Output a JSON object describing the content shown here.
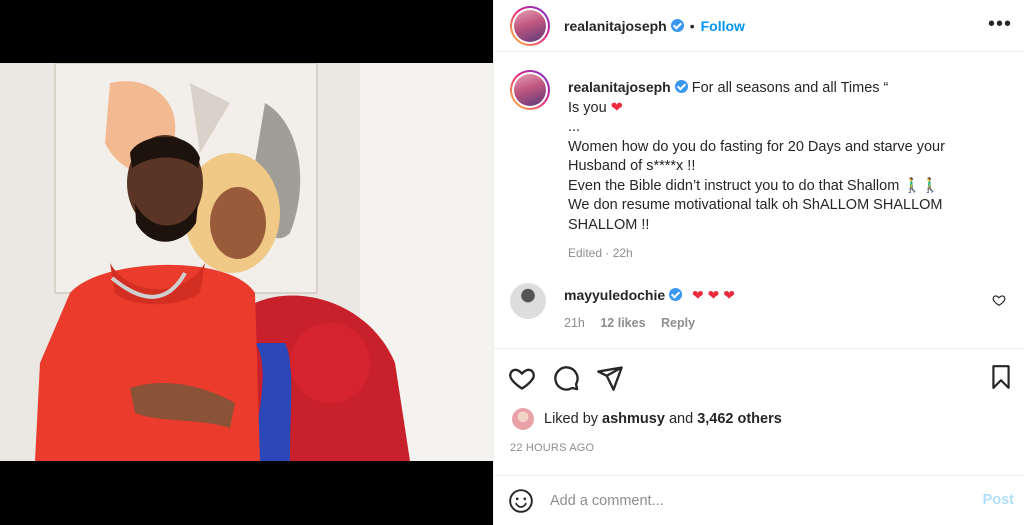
{
  "header": {
    "username": "realanitajoseph",
    "separator": "•",
    "follow_label": "Follow",
    "more_icon": "more-horizontal-icon"
  },
  "caption": {
    "username": "realanitajoseph",
    "line1": "For all seasons and all Times “",
    "line2": "Is you",
    "line2_heart": "❤",
    "line3": "...",
    "line4": "Women how do you do fasting for 20 Days and starve your",
    "line5": "Husband of s****x !!",
    "line6": "Even the Bible didn’t instruct you to do that Shallom 🚶‍♂️🚶‍♂️",
    "line7": "We don resume motivational talk oh ShALLOM SHALLOM",
    "line8": "SHALLOM !!",
    "meta": "Edited · 22h"
  },
  "comment": {
    "username": "mayyuledochie",
    "text": "❤ ❤ ❤",
    "time": "21h",
    "likes": "12 likes",
    "reply": "Reply"
  },
  "actions": {
    "like_icon": "heart-outline-icon",
    "comment_icon": "comment-icon",
    "share_icon": "share-icon",
    "save_icon": "bookmark-icon"
  },
  "likes": {
    "prefix": "Liked by",
    "user": "ashmusy",
    "mid": "and",
    "others": "3,462 others"
  },
  "timestamp": "22 HOURS AGO",
  "add_comment": {
    "placeholder": "Add a comment...",
    "post_label": "Post"
  },
  "colors": {
    "accent": "#0095f6",
    "heart": "#ed2d3d",
    "muted": "#8e8e8e",
    "post_disabled": "#b2dffc"
  }
}
